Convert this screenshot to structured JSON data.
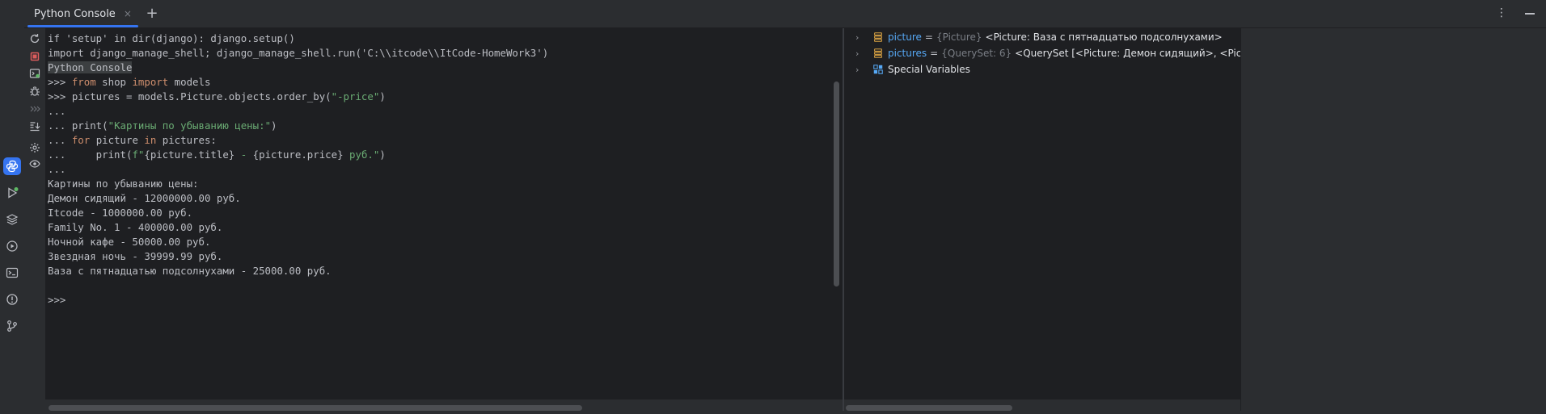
{
  "tab": {
    "title": "Python Console",
    "close_glyph": "×",
    "add_glyph": "+"
  },
  "header": {
    "more_glyph": "⋮"
  },
  "stripe_icons": [
    "python-console-icon",
    "run-icon",
    "layers-icon",
    "services-icon",
    "terminal-icon",
    "problems-icon",
    "git-icon"
  ],
  "actions": [
    "rerun-icon",
    "stop-icon",
    "console-history-icon",
    "debugger-icon",
    "show-more-icon",
    "scroll-to-end-icon",
    "settings-icon",
    "show-variables-icon"
  ],
  "console": {
    "lines": [
      [
        {
          "t": "if 'setup' in dir(django): django.setup()",
          "c": "mute"
        }
      ],
      [
        {
          "t": "import django_manage_shell; django_manage_shell.run('C:\\\\itcode\\\\ItCode-HomeWork3')",
          "c": "mute"
        }
      ],
      [
        {
          "t": "Python Console",
          "c": "hl"
        }
      ],
      [
        {
          "t": ">>> ",
          "c": "mute"
        },
        {
          "t": "from",
          "c": "kw"
        },
        {
          "t": " shop ",
          "c": "mute"
        },
        {
          "t": "import",
          "c": "kw"
        },
        {
          "t": " models",
          "c": "mute"
        }
      ],
      [
        {
          "t": ">>> pictures = models.Picture.objects.order_by(",
          "c": "mute"
        },
        {
          "t": "\"-price\"",
          "c": "str"
        },
        {
          "t": ")",
          "c": "mute"
        }
      ],
      [
        {
          "t": "...",
          "c": "mute"
        }
      ],
      [
        {
          "t": "... print(",
          "c": "mute"
        },
        {
          "t": "\"Картины по убыванию цены:\"",
          "c": "str"
        },
        {
          "t": ")",
          "c": "mute"
        }
      ],
      [
        {
          "t": "... ",
          "c": "mute"
        },
        {
          "t": "for",
          "c": "kw"
        },
        {
          "t": " picture ",
          "c": "mute"
        },
        {
          "t": "in",
          "c": "kw"
        },
        {
          "t": " pictures:",
          "c": "mute"
        }
      ],
      [
        {
          "t": "...     print(",
          "c": "mute"
        },
        {
          "t": "f\"",
          "c": "str"
        },
        {
          "t": "{picture.title}",
          "c": "mute"
        },
        {
          "t": " - ",
          "c": "str"
        },
        {
          "t": "{picture.price}",
          "c": "mute"
        },
        {
          "t": " руб.\"",
          "c": "str"
        },
        {
          "t": ")",
          "c": "mute"
        }
      ],
      [
        {
          "t": "...",
          "c": "mute"
        }
      ],
      [
        {
          "t": "Картины по убыванию цены:",
          "c": "mute"
        }
      ],
      [
        {
          "t": "Демон сидящий - 12000000.00 руб.",
          "c": "mute"
        }
      ],
      [
        {
          "t": "Itcode - 1000000.00 руб.",
          "c": "mute"
        }
      ],
      [
        {
          "t": "Family No. 1 - 400000.00 руб.",
          "c": "mute"
        }
      ],
      [
        {
          "t": "Ночной кафе - 50000.00 руб.",
          "c": "mute"
        }
      ],
      [
        {
          "t": "Звездная ночь - 39999.99 руб.",
          "c": "mute"
        }
      ],
      [
        {
          "t": "Ваза с пятнадцатью подсолнухами - 25000.00 руб.",
          "c": "mute"
        }
      ],
      [
        {
          "t": "",
          "c": "mute"
        }
      ],
      [
        {
          "t": ">>>",
          "c": "mute"
        }
      ]
    ]
  },
  "variables": [
    {
      "name": "picture",
      "eq": "=",
      "type": "{Picture}",
      "value": "<Picture: Ваза с пятнадцатью подсолнухами>",
      "icon": "object-icon"
    },
    {
      "name": "pictures",
      "eq": "=",
      "type": "{QuerySet: 6}",
      "value": "<QuerySet [<Picture: Демон сидящий>, <Picture: Itcode>, <",
      "icon": "object-icon"
    },
    {
      "name": "",
      "eq": "",
      "type": "",
      "value": "Special Variables",
      "icon": "special-variables-icon"
    }
  ],
  "colors": {
    "accent": "#3574f0",
    "keyword": "#cf8e6d",
    "string": "#6aab73",
    "var_name": "#56a8f5",
    "run_dot": "#5fb865"
  }
}
